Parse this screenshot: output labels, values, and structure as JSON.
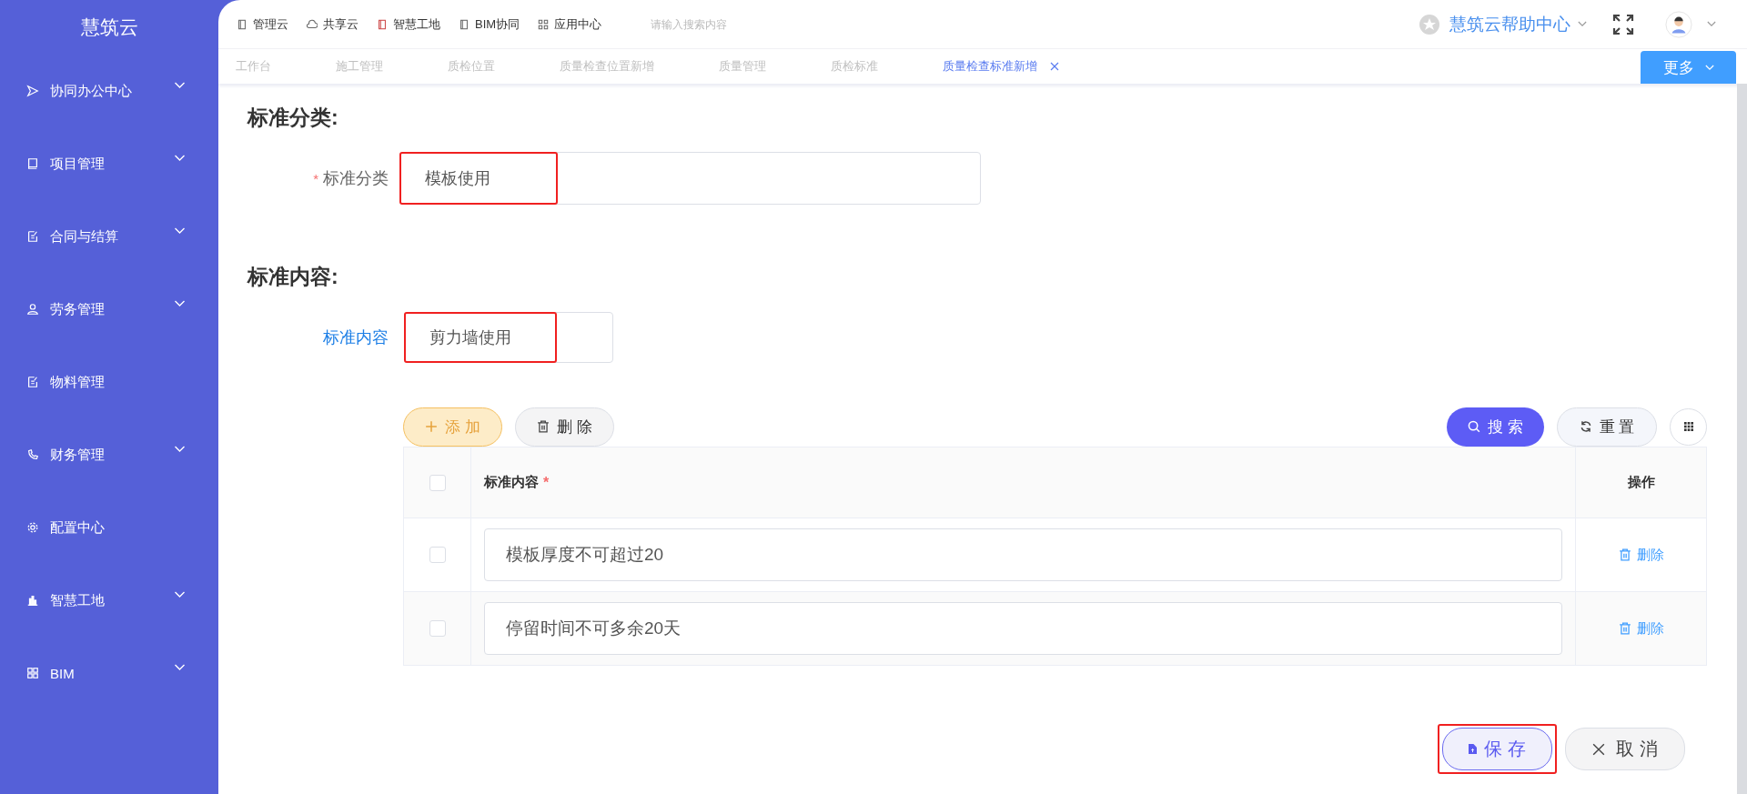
{
  "sidebar": {
    "title": "慧筑云",
    "items": [
      {
        "label": "协同办公中心",
        "expandable": true
      },
      {
        "label": "项目管理",
        "expandable": true
      },
      {
        "label": "合同与结算",
        "expandable": true
      },
      {
        "label": "劳务管理",
        "expandable": true
      },
      {
        "label": "物料管理",
        "expandable": false
      },
      {
        "label": "财务管理",
        "expandable": true
      },
      {
        "label": "配置中心",
        "expandable": false
      },
      {
        "label": "智慧工地",
        "expandable": true
      },
      {
        "label": "BIM",
        "expandable": true
      }
    ]
  },
  "topbar": {
    "links": [
      "管理云",
      "共享云",
      "智慧工地",
      "BIM协同",
      "应用中心"
    ],
    "search": {
      "placeholder": "请输入搜索内容"
    },
    "help": "慧筑云帮助中心"
  },
  "tabs": [
    {
      "label": "工作台",
      "selected": false
    },
    {
      "label": "施工管理",
      "selected": false
    },
    {
      "label": "质检位置",
      "selected": false
    },
    {
      "label": "质量检查位置新增",
      "selected": false
    },
    {
      "label": "质量管理",
      "selected": false
    },
    {
      "label": "质检标准",
      "selected": false
    },
    {
      "label": "质量检查标准新增",
      "selected": true
    }
  ],
  "more_button": "更多",
  "sections": [
    {
      "heading": "标准分类:",
      "label": "标准分类",
      "required_mark": "*",
      "value": "模板使用",
      "highlighted": true,
      "wide": true
    },
    {
      "heading": "标准内容:",
      "label": "标准内容",
      "value": "剪力墙使用",
      "highlighted": true,
      "wide": false
    }
  ],
  "toolbar": {
    "add": "添 加",
    "delete": "删 除",
    "search": "搜 索",
    "reset": "重 置"
  },
  "table": {
    "columns": [
      {
        "label": "标准内容",
        "required_mark": "*"
      },
      {
        "label": "操作"
      }
    ],
    "header_checked": false,
    "rows": [
      {
        "checked": false,
        "value": "模板厚度不可超过20",
        "action": "删除"
      },
      {
        "checked": false,
        "value": "停留时间不可多余20天",
        "action": "删除"
      }
    ]
  },
  "footer": {
    "save": "保 存",
    "save_highlighted": true,
    "cancel": "取 消"
  }
}
